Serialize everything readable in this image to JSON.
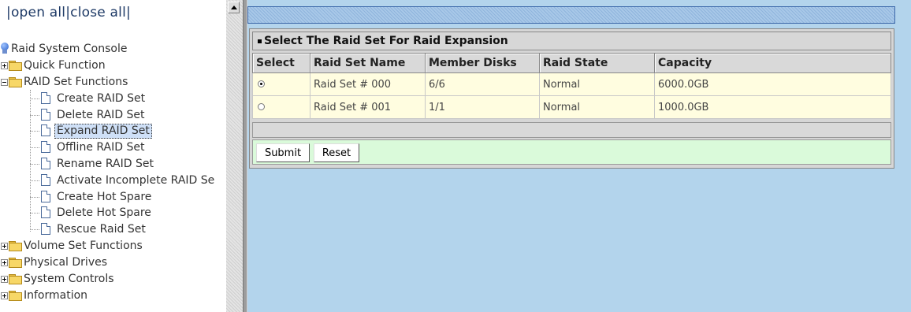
{
  "left": {
    "open_all": "open all",
    "close_all": "close all",
    "tree": {
      "root": "Raid System Console",
      "quick_function": "Quick Function",
      "raid_set_functions": "RAID Set Functions",
      "raid_children": [
        "Create RAID Set",
        "Delete RAID Set",
        "Expand RAID Set",
        "Offline RAID Set",
        "Rename RAID Set",
        "Activate Incomplete RAID Se",
        "Create Hot Spare",
        "Delete Hot Spare",
        "Rescue Raid Set"
      ],
      "selected_item": "Expand RAID Set",
      "volume_set_functions": "Volume Set Functions",
      "physical_drives": "Physical Drives",
      "system_controls": "System Controls",
      "information": "Information"
    }
  },
  "main": {
    "panel_title": "Select The Raid Set For Raid Expansion",
    "columns": [
      "Select",
      "Raid Set Name",
      "Member Disks",
      "Raid State",
      "Capacity"
    ],
    "rows": [
      {
        "selected": true,
        "name": "Raid Set # 000",
        "member_disks": "6/6",
        "state": "Normal",
        "capacity": "6000.0GB"
      },
      {
        "selected": false,
        "name": "Raid Set # 001",
        "member_disks": "1/1",
        "state": "Normal",
        "capacity": "1000.0GB"
      }
    ],
    "submit_label": "Submit",
    "reset_label": "Reset"
  },
  "colors": {
    "right_background": "#b3d4ec",
    "row_background": "#fffde0",
    "button_row_background": "#dafada"
  }
}
